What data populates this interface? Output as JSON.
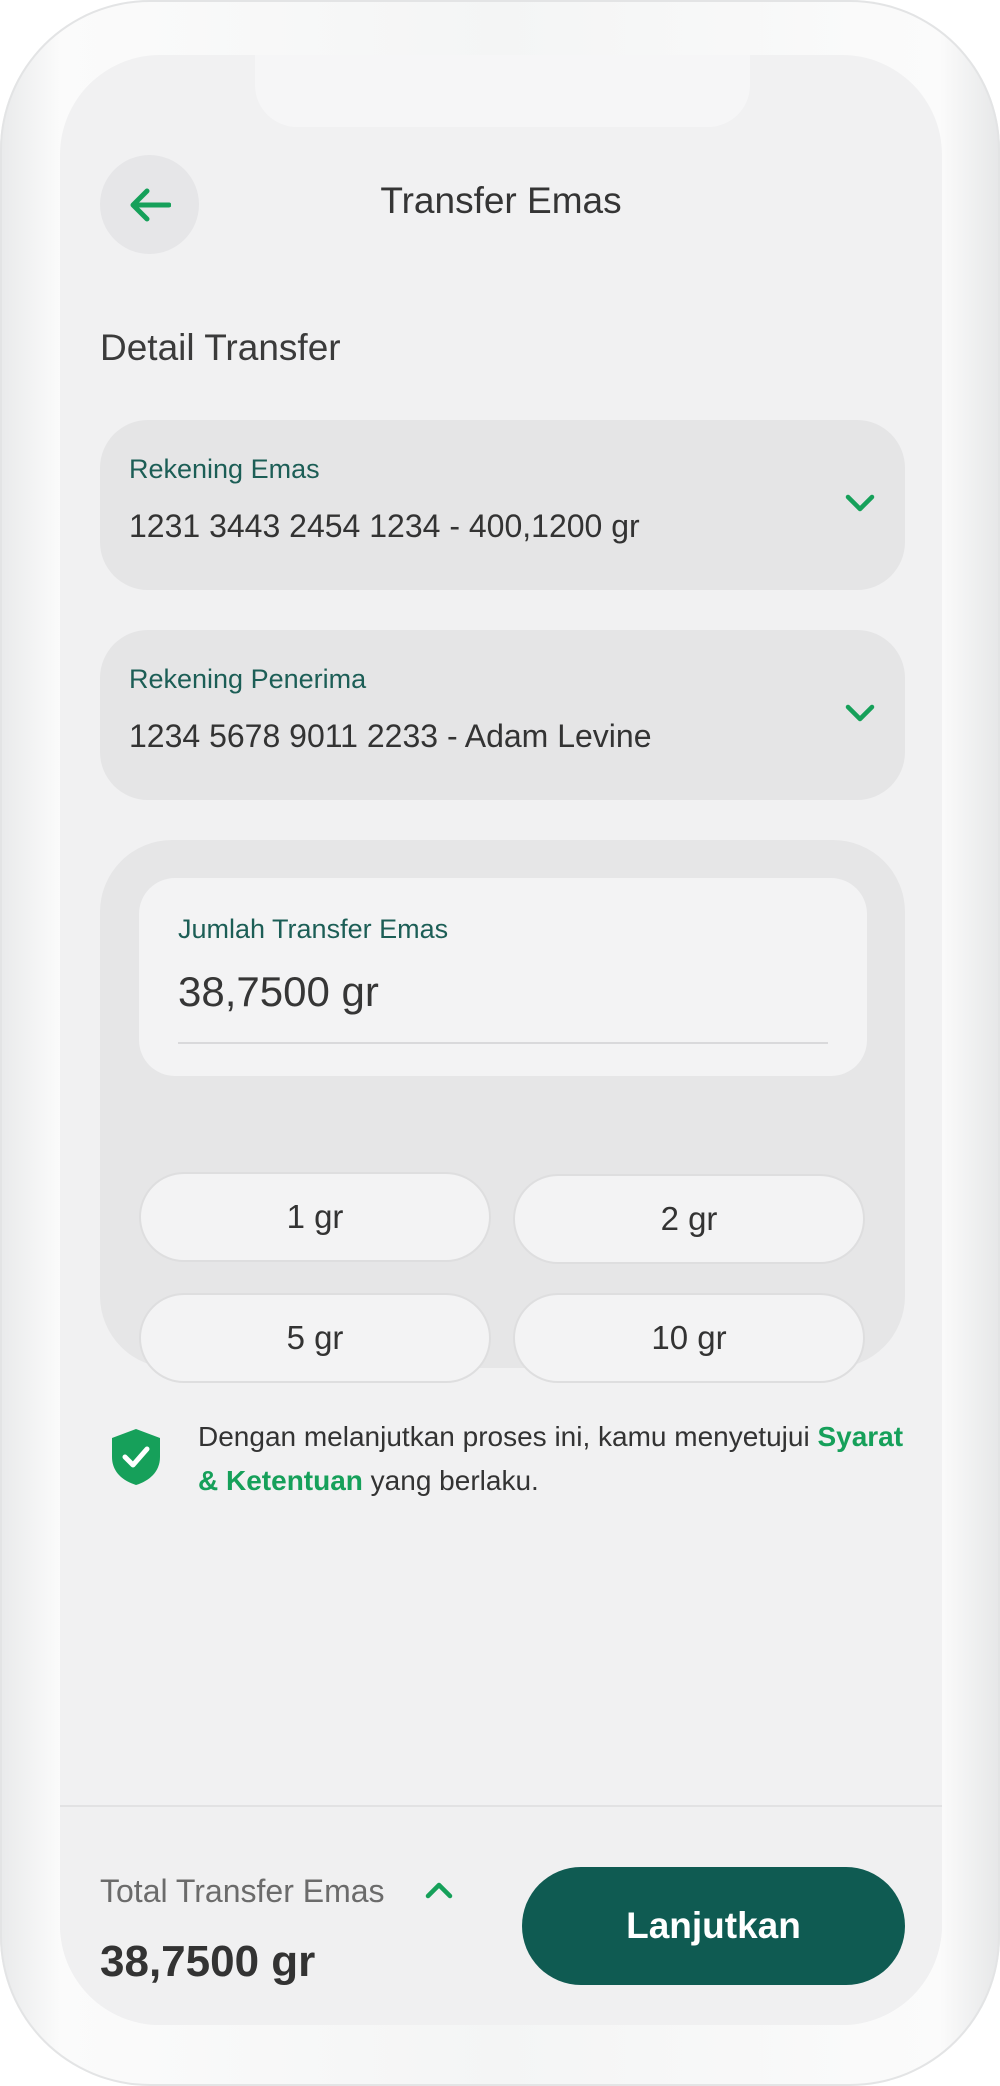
{
  "header": {
    "title": "Transfer Emas"
  },
  "section": {
    "title": "Detail Transfer"
  },
  "source_account": {
    "label": "Rekening Emas",
    "value": "1231 3443 2454 1234 - 400,1200 gr"
  },
  "recipient_account": {
    "label": "Rekening Penerima",
    "value": "1234 5678 9011 2233 - Adam Levine"
  },
  "amount": {
    "label": "Jumlah Transfer Emas",
    "value": "38,7500 gr",
    "presets": [
      "1 gr",
      "2 gr",
      "5 gr",
      "10 gr"
    ]
  },
  "consent": {
    "text_before": "Dengan melanjutkan proses ini, kamu menyetujui ",
    "link": "Syarat & Ketentuan",
    "text_after": " yang berlaku."
  },
  "footer": {
    "total_label": "Total Transfer Emas",
    "total_value": "38,7500 gr",
    "continue_label": "Lanjutkan"
  },
  "icons": {
    "back": "arrow-left-icon",
    "dropdown": "chevron-down-icon",
    "expand": "chevron-up-icon",
    "consent": "shield-check-icon"
  },
  "colors": {
    "accent": "#16a05a",
    "primary_button": "#0f5b52",
    "label_green": "#1c5e56"
  }
}
